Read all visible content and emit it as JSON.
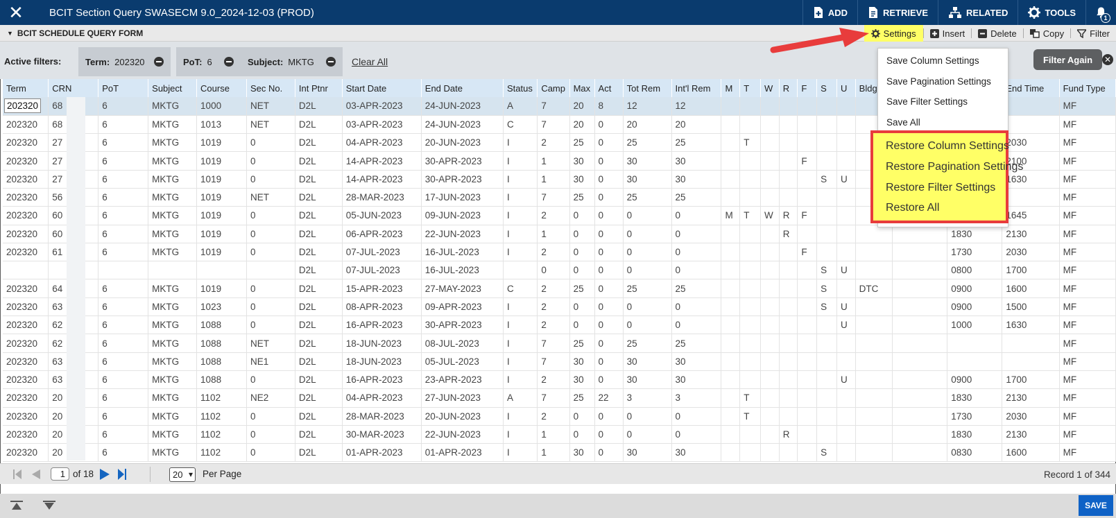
{
  "app": {
    "title": "BCIT Section Query SWASECM 9.0_2024-12-03 (PROD)",
    "close_icon": "close-icon",
    "actions": [
      {
        "label": "ADD",
        "icon": "add-icon"
      },
      {
        "label": "RETRIEVE",
        "icon": "retrieve-icon"
      },
      {
        "label": "RELATED",
        "icon": "related-icon"
      },
      {
        "label": "TOOLS",
        "icon": "gear-icon"
      }
    ],
    "notification_count": "1"
  },
  "form": {
    "title": "BCIT SCHEDULE QUERY FORM",
    "tools": {
      "settings": "Settings",
      "insert": "Insert",
      "delete": "Delete",
      "copy": "Copy",
      "filter": "Filter"
    }
  },
  "filters": {
    "label": "Active filters:",
    "chips": [
      {
        "name": "Term:",
        "value": "202320"
      },
      {
        "name": "PoT:",
        "value": "6"
      },
      {
        "name": "Subject:",
        "value": "MKTG"
      }
    ],
    "clear_all": "Clear All",
    "filter_again": "Filter Again"
  },
  "table": {
    "columns": [
      "Term",
      "CRN",
      "PoT",
      "Subject",
      "Course",
      "Sec No.",
      "Int Ptnr",
      "Start Date",
      "End Date",
      "Status",
      "Camp",
      "Max",
      "Act",
      "Tot Rem",
      "Int'l Rem",
      "M",
      "T",
      "W",
      "R",
      "F",
      "S",
      "U",
      "Bldg",
      "",
      "",
      "End Time",
      "Fund Type"
    ],
    "rows": [
      [
        "202320",
        "68",
        "6",
        "MKTG",
        "1000",
        "NET",
        "D2L",
        "03-APR-2023",
        "24-JUN-2023",
        "A",
        "7",
        "20",
        "8",
        "12",
        "12",
        "",
        "",
        "",
        "",
        "",
        "",
        "",
        "",
        "",
        "",
        "",
        "MF"
      ],
      [
        "202320",
        "68",
        "6",
        "MKTG",
        "1013",
        "NET",
        "D2L",
        "03-APR-2023",
        "24-JUN-2023",
        "C",
        "7",
        "20",
        "0",
        "20",
        "20",
        "",
        "",
        "",
        "",
        "",
        "",
        "",
        "",
        "",
        "",
        "",
        "MF"
      ],
      [
        "202320",
        "27",
        "6",
        "MKTG",
        "1019",
        "0",
        "D2L",
        "04-APR-2023",
        "20-JUN-2023",
        "I",
        "2",
        "25",
        "0",
        "25",
        "25",
        "",
        "T",
        "",
        "",
        "",
        "",
        "",
        "",
        "",
        "",
        "2030",
        "MF"
      ],
      [
        "202320",
        "27",
        "6",
        "MKTG",
        "1019",
        "0",
        "D2L",
        "14-APR-2023",
        "30-APR-2023",
        "I",
        "1",
        "30",
        "0",
        "30",
        "30",
        "",
        "",
        "",
        "",
        "F",
        "",
        "",
        "",
        "",
        "",
        "2100",
        "MF"
      ],
      [
        "202320",
        "27",
        "6",
        "MKTG",
        "1019",
        "0",
        "D2L",
        "14-APR-2023",
        "30-APR-2023",
        "I",
        "1",
        "30",
        "0",
        "30",
        "30",
        "",
        "",
        "",
        "",
        "",
        "S",
        "U",
        "",
        "",
        "",
        "1630",
        "MF"
      ],
      [
        "202320",
        "56",
        "6",
        "MKTG",
        "1019",
        "NET",
        "D2L",
        "28-MAR-2023",
        "17-JUN-2023",
        "I",
        "7",
        "25",
        "0",
        "25",
        "25",
        "",
        "",
        "",
        "",
        "",
        "",
        "",
        "",
        "",
        "",
        "",
        "MF"
      ],
      [
        "202320",
        "60",
        "6",
        "MKTG",
        "1019",
        "0",
        "D2L",
        "05-JUN-2023",
        "09-JUN-2023",
        "I",
        "2",
        "0",
        "0",
        "0",
        "0",
        "M",
        "T",
        "W",
        "R",
        "F",
        "",
        "",
        "",
        "",
        "",
        "1645",
        "MF"
      ],
      [
        "202320",
        "60",
        "6",
        "MKTG",
        "1019",
        "0",
        "D2L",
        "06-APR-2023",
        "22-JUN-2023",
        "I",
        "1",
        "0",
        "0",
        "0",
        "0",
        "",
        "",
        "",
        "R",
        "",
        "",
        "",
        "",
        "",
        "1830",
        "2130",
        "MF"
      ],
      [
        "202320",
        "61",
        "6",
        "MKTG",
        "1019",
        "0",
        "D2L",
        "07-JUL-2023",
        "16-JUL-2023",
        "I",
        "2",
        "0",
        "0",
        "0",
        "0",
        "",
        "",
        "",
        "",
        "F",
        "",
        "",
        "",
        "",
        "1730",
        "2030",
        "MF"
      ],
      [
        "",
        "",
        "",
        "",
        "",
        "",
        "D2L",
        "07-JUL-2023",
        "16-JUL-2023",
        "",
        "0",
        "0",
        "0",
        "0",
        "0",
        "",
        "",
        "",
        "",
        "",
        "S",
        "U",
        "",
        "",
        "0800",
        "1700",
        "MF"
      ],
      [
        "202320",
        "64",
        "6",
        "MKTG",
        "1019",
        "0",
        "D2L",
        "15-APR-2023",
        "27-MAY-2023",
        "C",
        "2",
        "25",
        "0",
        "25",
        "25",
        "",
        "",
        "",
        "",
        "",
        "S",
        "",
        "DTC",
        "",
        "0900",
        "1600",
        "MF"
      ],
      [
        "202320",
        "63",
        "6",
        "MKTG",
        "1023",
        "0",
        "D2L",
        "08-APR-2023",
        "09-APR-2023",
        "I",
        "2",
        "0",
        "0",
        "0",
        "0",
        "",
        "",
        "",
        "",
        "",
        "S",
        "U",
        "",
        "",
        "0900",
        "1500",
        "MF"
      ],
      [
        "202320",
        "62",
        "6",
        "MKTG",
        "1088",
        "0",
        "D2L",
        "16-APR-2023",
        "30-APR-2023",
        "I",
        "2",
        "0",
        "0",
        "0",
        "0",
        "",
        "",
        "",
        "",
        "",
        "",
        "U",
        "",
        "",
        "1000",
        "1630",
        "MF"
      ],
      [
        "202320",
        "62",
        "6",
        "MKTG",
        "1088",
        "NET",
        "D2L",
        "18-JUN-2023",
        "08-JUL-2023",
        "I",
        "7",
        "25",
        "0",
        "25",
        "25",
        "",
        "",
        "",
        "",
        "",
        "",
        "",
        "",
        "",
        "",
        "",
        "MF"
      ],
      [
        "202320",
        "63",
        "6",
        "MKTG",
        "1088",
        "NE1",
        "D2L",
        "18-JUN-2023",
        "05-JUL-2023",
        "I",
        "7",
        "30",
        "0",
        "30",
        "30",
        "",
        "",
        "",
        "",
        "",
        "",
        "",
        "",
        "",
        "",
        "",
        "MF"
      ],
      [
        "202320",
        "63",
        "6",
        "MKTG",
        "1088",
        "0",
        "D2L",
        "16-APR-2023",
        "23-APR-2023",
        "I",
        "2",
        "30",
        "0",
        "30",
        "30",
        "",
        "",
        "",
        "",
        "",
        "",
        "U",
        "",
        "",
        "0900",
        "1700",
        "MF"
      ],
      [
        "202320",
        "20",
        "6",
        "MKTG",
        "1102",
        "NE2",
        "D2L",
        "04-APR-2023",
        "27-JUN-2023",
        "A",
        "7",
        "25",
        "22",
        "3",
        "3",
        "",
        "T",
        "",
        "",
        "",
        "",
        "",
        "",
        "",
        "1830",
        "2130",
        "MF"
      ],
      [
        "202320",
        "20",
        "6",
        "MKTG",
        "1102",
        "0",
        "D2L",
        "28-MAR-2023",
        "20-JUN-2023",
        "I",
        "2",
        "0",
        "0",
        "0",
        "0",
        "",
        "T",
        "",
        "",
        "",
        "",
        "",
        "",
        "",
        "1730",
        "2030",
        "MF"
      ],
      [
        "202320",
        "20",
        "6",
        "MKTG",
        "1102",
        "0",
        "D2L",
        "30-MAR-2023",
        "22-JUN-2023",
        "I",
        "1",
        "0",
        "0",
        "0",
        "0",
        "",
        "",
        "",
        "R",
        "",
        "",
        "",
        "",
        "",
        "1830",
        "2130",
        "MF"
      ],
      [
        "202320",
        "20",
        "6",
        "MKTG",
        "1102",
        "0",
        "D2L",
        "01-APR-2023",
        "01-APR-2023",
        "I",
        "1",
        "30",
        "0",
        "30",
        "30",
        "",
        "",
        "",
        "",
        "",
        "S",
        "",
        "",
        "",
        "0830",
        "1600",
        "MF"
      ]
    ]
  },
  "pagination": {
    "page": "1",
    "of_label": "of 18",
    "per_page_value": "20",
    "per_page_label": "Per Page",
    "record": "Record 1 of 344"
  },
  "settings_menu": {
    "save_items": [
      "Save Column Settings",
      "Save Pagination Settings",
      "Save Filter Settings",
      "Save All"
    ],
    "restore_items": [
      "Restore Column Settings",
      "Restore Pagination Settings",
      "Restore Filter Settings",
      "Restore All"
    ]
  },
  "footer": {
    "save": "SAVE"
  },
  "colors": {
    "header_bg": "#0a3b6e",
    "highlight": "#ffff66",
    "annotation_red": "#e83c3c",
    "save_blue": "#0f62c6",
    "column_header_bg": "#d7e7f5"
  }
}
